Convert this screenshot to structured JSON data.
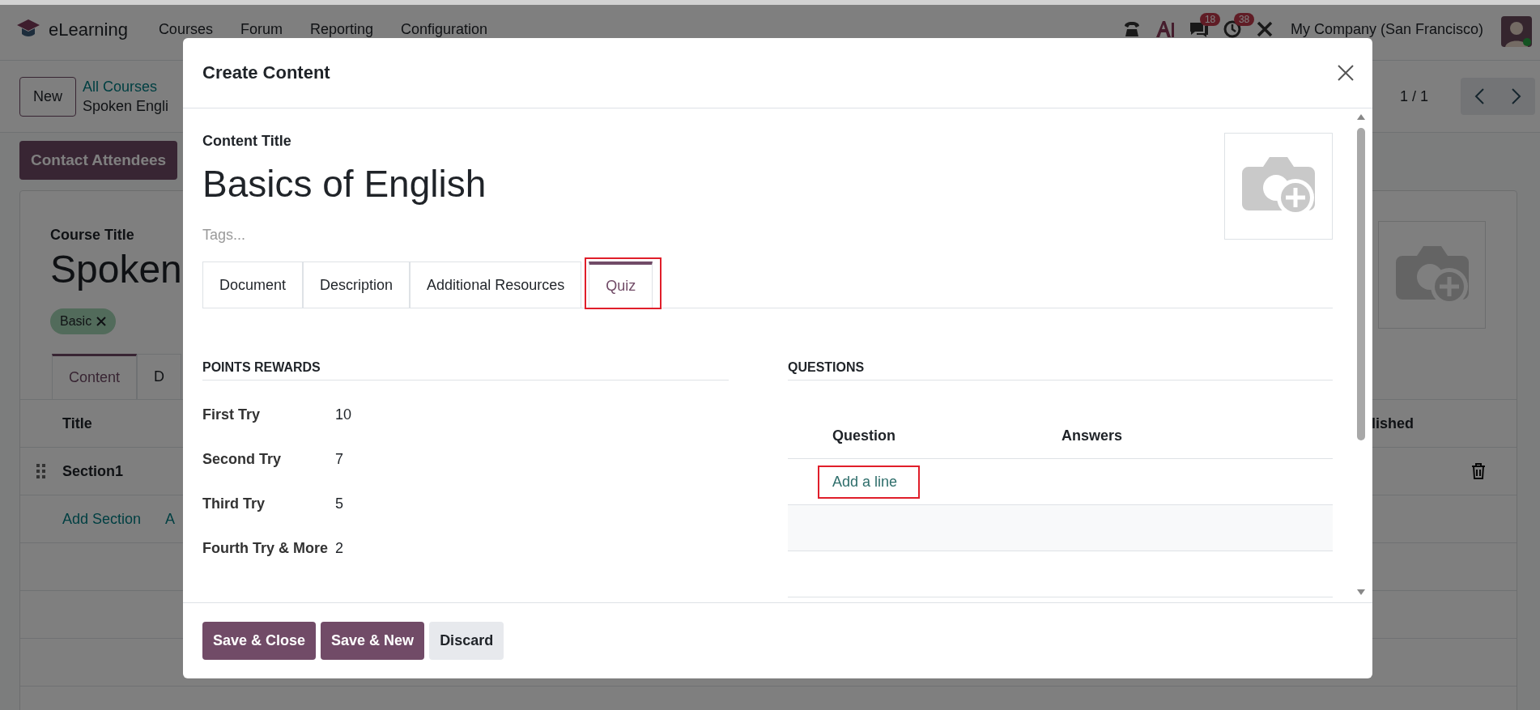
{
  "navbar": {
    "app_name": "eLearning",
    "menu": [
      "Courses",
      "Forum",
      "Reporting",
      "Configuration"
    ],
    "chat_count": "18",
    "activity_count": "38",
    "company": "My Company (San Francisco)"
  },
  "control_panel": {
    "new_button": "New",
    "breadcrumb_parent": "All Courses",
    "breadcrumb_current": "Spoken Engli",
    "pager": "1 / 1"
  },
  "action_button": "Contact Attendees",
  "course": {
    "title_label": "Course Title",
    "title": "Spoken",
    "tags": [
      "Basic"
    ],
    "tabs": [
      {
        "label": "Content",
        "selected": true
      },
      {
        "label": "D",
        "selected": false
      }
    ],
    "columns": [
      "Title",
      "lished"
    ],
    "rows": [
      {
        "title": "Section1"
      }
    ],
    "add_links": [
      "Add Section",
      "A"
    ]
  },
  "dialog": {
    "title": "Create Content",
    "content_title_label": "Content Title",
    "content_title": "Basics of English",
    "tags_placeholder": "Tags...",
    "tabs": [
      {
        "label": "Document",
        "selected": false,
        "highlighted": false
      },
      {
        "label": "Description",
        "selected": false,
        "highlighted": false
      },
      {
        "label": "Additional Resources",
        "selected": false,
        "highlighted": false
      },
      {
        "label": "Quiz",
        "selected": true,
        "highlighted": true
      }
    ],
    "points": {
      "heading": "POINTS REWARDS",
      "rows": [
        {
          "label": "First Try",
          "value": "10"
        },
        {
          "label": "Second Try",
          "value": "7"
        },
        {
          "label": "Third Try",
          "value": "5"
        },
        {
          "label": "Fourth Try & More",
          "value": "2"
        }
      ]
    },
    "questions": {
      "heading": "QUESTIONS",
      "columns": [
        "Question",
        "Answers"
      ],
      "add_line": {
        "label": "Add a line",
        "highlighted": true
      }
    },
    "buttons": [
      {
        "label": "Save & Close",
        "kind": "primary"
      },
      {
        "label": "Save & New",
        "kind": "primary"
      },
      {
        "label": "Discard",
        "kind": "secondary"
      }
    ]
  }
}
